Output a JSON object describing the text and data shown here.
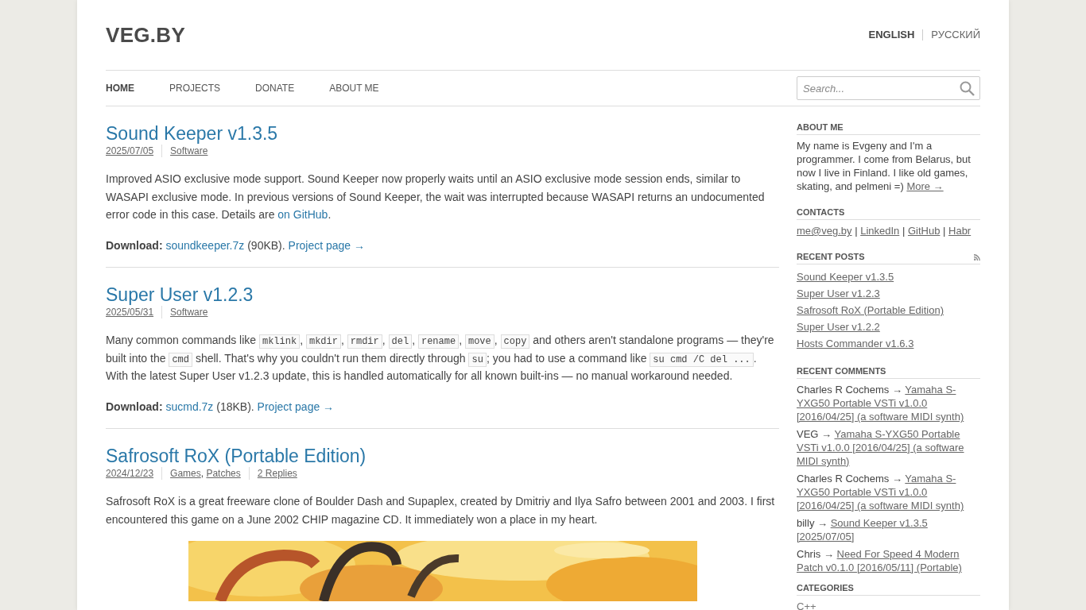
{
  "site": {
    "logo": "VEG.BY",
    "languages": [
      {
        "label": "ENGLISH",
        "selected": true
      },
      {
        "label": "РУССКИЙ",
        "selected": false
      }
    ]
  },
  "nav": {
    "items": [
      {
        "label": "HOME",
        "selected": true
      },
      {
        "label": "PROJECTS",
        "selected": false
      },
      {
        "label": "DONATE",
        "selected": false
      },
      {
        "label": "ABOUT ME",
        "selected": false
      }
    ],
    "search": {
      "placeholder": "Search..."
    }
  },
  "posts": [
    {
      "title": "Sound Keeper v1.3.5",
      "meta": {
        "date": "2025/07/05",
        "categories": [
          {
            "kind": "link",
            "text": "Software"
          }
        ]
      },
      "paragraphs": [
        [
          {
            "kind": "text",
            "text": "Improved ASIO exclusive mode support. Sound Keeper now properly waits until an ASIO exclusive mode session ends, similar to WASAPI exclusive mode. In previous versions of Sound Keeper, the wait was interrupted because WASAPI returns an undocumented error code in this case. Details are "
          },
          {
            "kind": "link",
            "text": "on GitHub"
          },
          {
            "kind": "text",
            "text": "."
          }
        ],
        [
          {
            "kind": "text",
            "text": "**Download:** "
          },
          {
            "kind": "link",
            "text": "soundkeeper.7z"
          },
          {
            "kind": "text",
            "text": " (90KB). "
          },
          {
            "kind": "link",
            "text": "Project page →"
          }
        ]
      ]
    },
    {
      "title": "Super User v1.2.3",
      "meta": {
        "date": "2025/05/31",
        "categories": [
          {
            "kind": "link",
            "text": "Software"
          }
        ]
      },
      "paragraphs": [
        [
          {
            "kind": "text",
            "text": "Many common commands like "
          },
          {
            "kind": "code",
            "text": "mklink"
          },
          {
            "kind": "text",
            "text": ", "
          },
          {
            "kind": "code",
            "text": "mkdir"
          },
          {
            "kind": "text",
            "text": ", "
          },
          {
            "kind": "code",
            "text": "rmdir"
          },
          {
            "kind": "text",
            "text": ", "
          },
          {
            "kind": "code",
            "text": "del"
          },
          {
            "kind": "text",
            "text": ", "
          },
          {
            "kind": "code",
            "text": "rename"
          },
          {
            "kind": "text",
            "text": ", "
          },
          {
            "kind": "code",
            "text": "move"
          },
          {
            "kind": "text",
            "text": ", "
          },
          {
            "kind": "code",
            "text": "copy"
          },
          {
            "kind": "text",
            "text": " and others aren't standalone programs — they're built into the "
          },
          {
            "kind": "code",
            "text": "cmd"
          },
          {
            "kind": "text",
            "text": " shell. That's why you couldn't run them directly through "
          },
          {
            "kind": "code",
            "text": "su"
          },
          {
            "kind": "text",
            "text": "; you had to use a command like "
          },
          {
            "kind": "code",
            "text": "su cmd /C del ..."
          },
          {
            "kind": "text",
            "text": ". With the latest Super User v1.2.3 update, this is handled automatically for all known built-ins — no manual workaround needed."
          }
        ],
        [
          {
            "kind": "text",
            "text": "**Download:** "
          },
          {
            "kind": "link",
            "text": "sucmd.7z"
          },
          {
            "kind": "text",
            "text": " (18KB). "
          },
          {
            "kind": "link",
            "text": "Project page →"
          }
        ]
      ]
    },
    {
      "title": "Safrosoft RoX (Portable Edition)",
      "meta": {
        "date": "2024/12/23",
        "categories": [
          {
            "kind": "link",
            "text": "Games"
          },
          {
            "kind": "text",
            "text": ", "
          },
          {
            "kind": "link",
            "text": "Patches"
          }
        ],
        "replies": "2 Replies"
      },
      "paragraphs": [
        [
          {
            "kind": "text",
            "text": "Safrosoft RoX is a great freeware clone of Boulder Dash and Supaplex, created by Dmitriy and Ilya Safro between 2001 and 2003. I first encountered this game on a June 2002 CHIP magazine CD. It immediately won a place in my heart."
          }
        ]
      ],
      "picture": {
        "kind": "picture"
      }
    }
  ],
  "sidebar": [
    {
      "kind": "paragraph",
      "title": "ABOUT ME",
      "segments": [
        {
          "kind": "text",
          "text": "My name is Evgeny and I'm a programmer. I come from Belarus, but now I live in Finland. I like old games, skating, and pelmeni =) "
        },
        {
          "kind": "link",
          "text": "More →"
        }
      ]
    },
    {
      "kind": "paragraph",
      "title": "CONTACTS",
      "segments": [
        {
          "kind": "link",
          "text": "me@veg.by"
        },
        {
          "kind": "text",
          "text": " | "
        },
        {
          "kind": "link",
          "text": "LinkedIn"
        },
        {
          "kind": "text",
          "text": " | "
        },
        {
          "kind": "link",
          "text": "GitHub"
        },
        {
          "kind": "text",
          "text": " | "
        },
        {
          "kind": "link",
          "text": "Habr"
        }
      ]
    },
    {
      "kind": "links",
      "title": "RECENT POSTS",
      "rss": true,
      "links": [
        "Sound Keeper v1.3.5",
        "Super User v1.2.3",
        "Safrosoft RoX (Portable Edition)",
        "Super User v1.2.2",
        "Hosts Commander v1.6.3"
      ]
    },
    {
      "kind": "comments",
      "title": "RECENT COMMENTS",
      "comments": [
        {
          "author": "Charles R Cochems →",
          "link": "Yamaha S-YXG50 Portable VSTi v1.0.0 [2016/04/25] (a software MIDI synth)"
        },
        {
          "author": "VEG →",
          "link": "Yamaha S-YXG50 Portable VSTi v1.0.0 [2016/04/25] (a software MIDI synth)"
        },
        {
          "author": "Charles R Cochems →",
          "link": "Yamaha S-YXG50 Portable VSTi v1.0.0 [2016/04/25] (a software MIDI synth)"
        },
        {
          "author": "billy →",
          "link": "Sound Keeper v1.3.5 [2025/07/05]"
        },
        {
          "author": "Chris →",
          "link": "Need For Speed 4 Modern Patch v0.1.0 [2016/05/11] (Portable)"
        }
      ]
    },
    {
      "kind": "plain",
      "title": "CATEGORIES",
      "links": [
        "C++"
      ]
    }
  ]
}
